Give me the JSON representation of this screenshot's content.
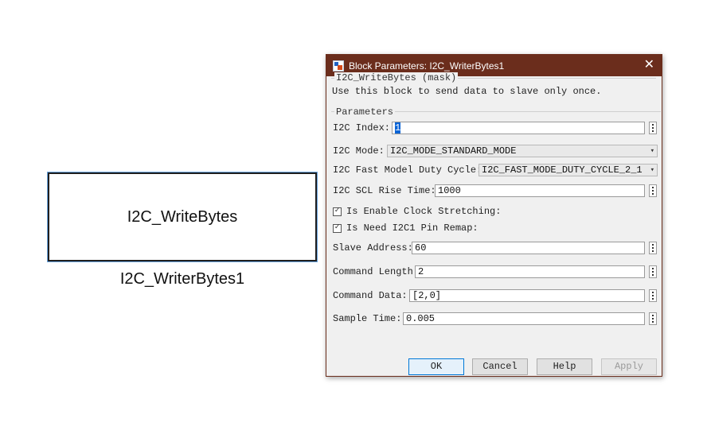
{
  "model": {
    "block_label": "I2C_WriteBytes",
    "block_name": "I2C_WriterBytes1"
  },
  "dialog": {
    "title": "Block Parameters: I2C_WriterBytes1",
    "mask_title": "I2C_WriteBytes (mask)",
    "description": "Use this block to send data to slave only once.",
    "params_legend": "Parameters",
    "fields": {
      "i2c_index": {
        "label": "I2C Index:",
        "value": "1"
      },
      "i2c_mode": {
        "label": "I2C Mode:",
        "value": "I2C_MODE_STANDARD_MODE"
      },
      "fast_duty": {
        "label": "I2C Fast Model Duty Cycle:",
        "value": "I2C_FAST_MODE_DUTY_CYCLE_2_1"
      },
      "scl_rise": {
        "label": "I2C SCL Rise Time:",
        "value": "1000"
      },
      "clock_stretch": {
        "label": "Is Enable Clock Stretching:",
        "checked": true
      },
      "pin_remap": {
        "label": "Is Need I2C1 Pin Remap:",
        "checked": true
      },
      "slave_addr": {
        "label": "Slave Address:",
        "value": "60"
      },
      "cmd_len": {
        "label": "Command Length:",
        "value": "2"
      },
      "cmd_data": {
        "label": "Command Data:",
        "value": "[2,0]"
      },
      "sample_time": {
        "label": "Sample Time:",
        "value": "0.005"
      }
    },
    "buttons": {
      "ok": "OK",
      "cancel": "Cancel",
      "help": "Help",
      "apply": "Apply"
    },
    "colors": {
      "titlebar": "#6b2d1c",
      "selection": "#0a64d6"
    }
  }
}
